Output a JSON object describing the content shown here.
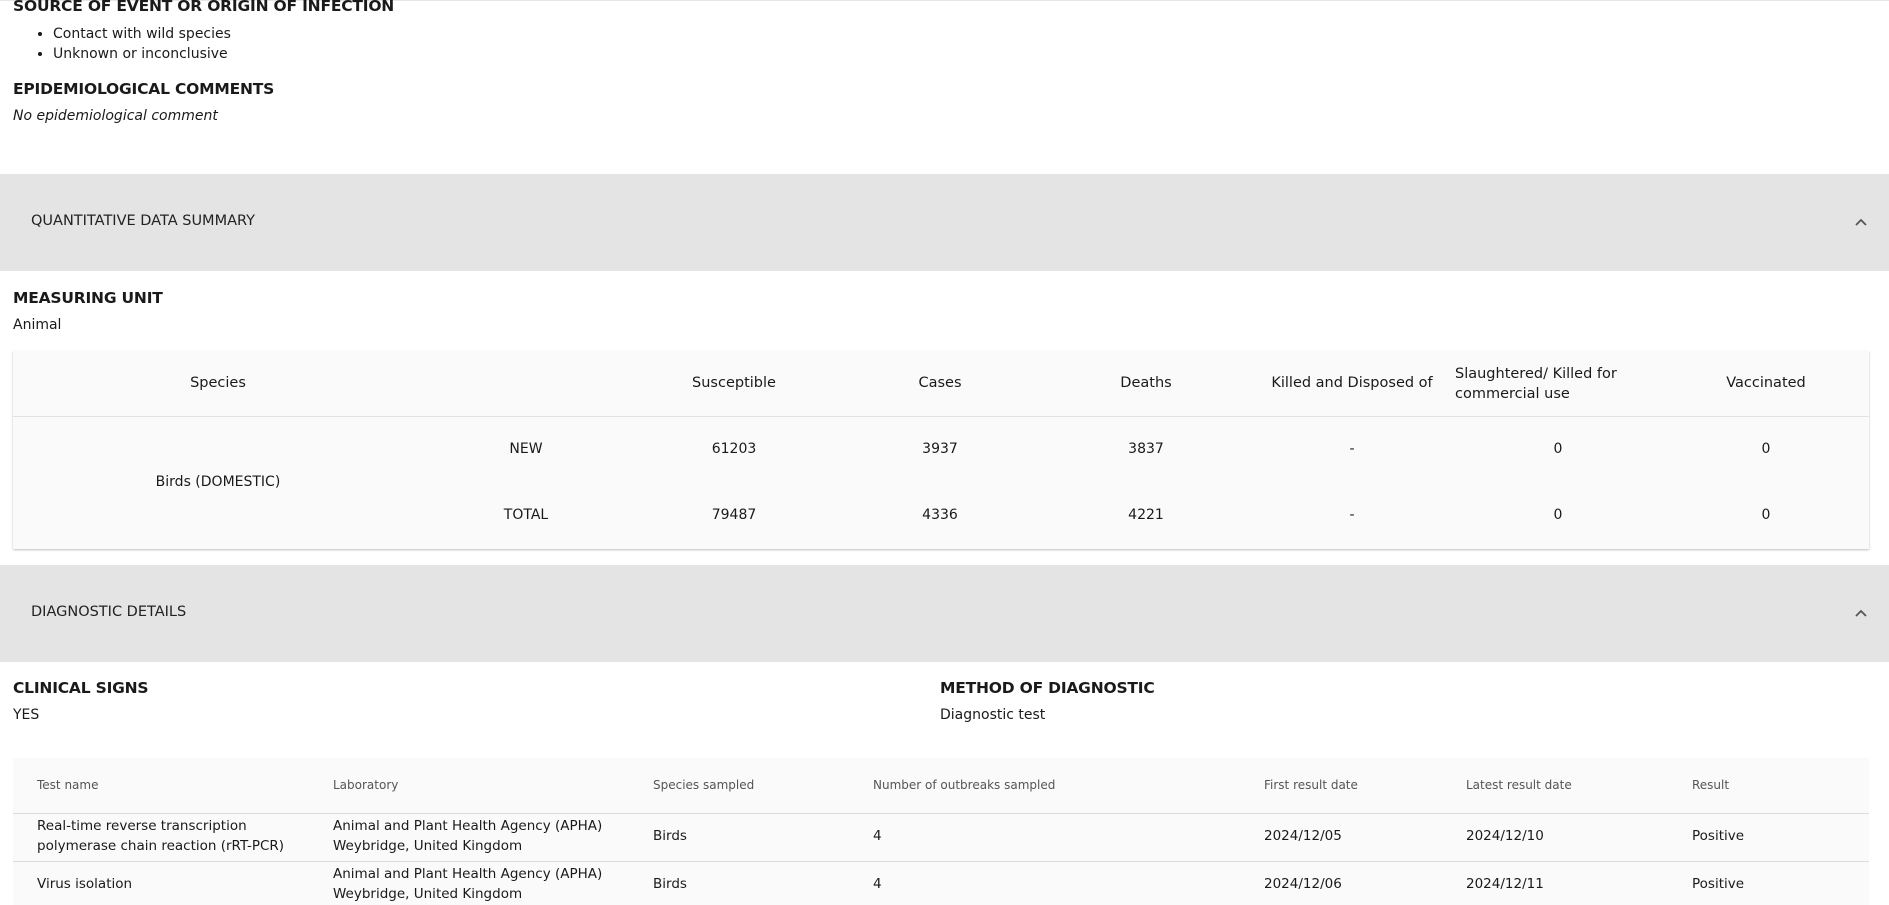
{
  "source": {
    "heading": "SOURCE OF EVENT OR ORIGIN OF INFECTION",
    "items": [
      "Contact with wild species",
      "Unknown or inconclusive"
    ]
  },
  "epi": {
    "heading": "EPIDEMIOLOGICAL COMMENTS",
    "text": "No epidemiological comment"
  },
  "quantitative": {
    "section_title": "QUANTITATIVE DATA SUMMARY",
    "measuring_unit_heading": "MEASURING UNIT",
    "measuring_unit_value": "Animal",
    "headers": {
      "species": "Species",
      "susceptible": "Susceptible",
      "cases": "Cases",
      "deaths": "Deaths",
      "killed": "Killed and Disposed of",
      "slaughtered": "Slaughtered/ Killed for commercial use",
      "vaccinated": "Vaccinated"
    },
    "species_name": "Birds (DOMESTIC)",
    "rows": [
      {
        "label": "NEW",
        "susceptible": "61203",
        "cases": "3937",
        "deaths": "3837",
        "killed": "-",
        "slaughtered": "0",
        "vaccinated": "0"
      },
      {
        "label": "TOTAL",
        "susceptible": "79487",
        "cases": "4336",
        "deaths": "4221",
        "killed": "-",
        "slaughtered": "0",
        "vaccinated": "0"
      }
    ]
  },
  "diagnostic": {
    "section_title": "DIAGNOSTIC DETAILS",
    "clinical_heading": "CLINICAL SIGNS",
    "clinical_value": "YES",
    "method_heading": "METHOD OF DIAGNOSTIC",
    "method_value": "Diagnostic test",
    "headers": {
      "test": "Test name",
      "lab": "Laboratory",
      "species": "Species sampled",
      "outbreaks": "Number of outbreaks sampled",
      "first": "First result date",
      "latest": "Latest result date",
      "result": "Result"
    },
    "rows": [
      {
        "test": "Real-time reverse transcription polymerase chain reaction (rRT-PCR)",
        "lab": "Animal and Plant Health Agency (APHA) Weybridge, United Kingdom",
        "species": "Birds",
        "outbreaks": "4",
        "first": "2024/12/05",
        "latest": "2024/12/10",
        "result": "Positive"
      },
      {
        "test": "Virus isolation",
        "lab": "Animal and Plant Health Agency (APHA) Weybridge, United Kingdom",
        "species": "Birds",
        "outbreaks": "4",
        "first": "2024/12/06",
        "latest": "2024/12/11",
        "result": "Positive"
      }
    ]
  }
}
